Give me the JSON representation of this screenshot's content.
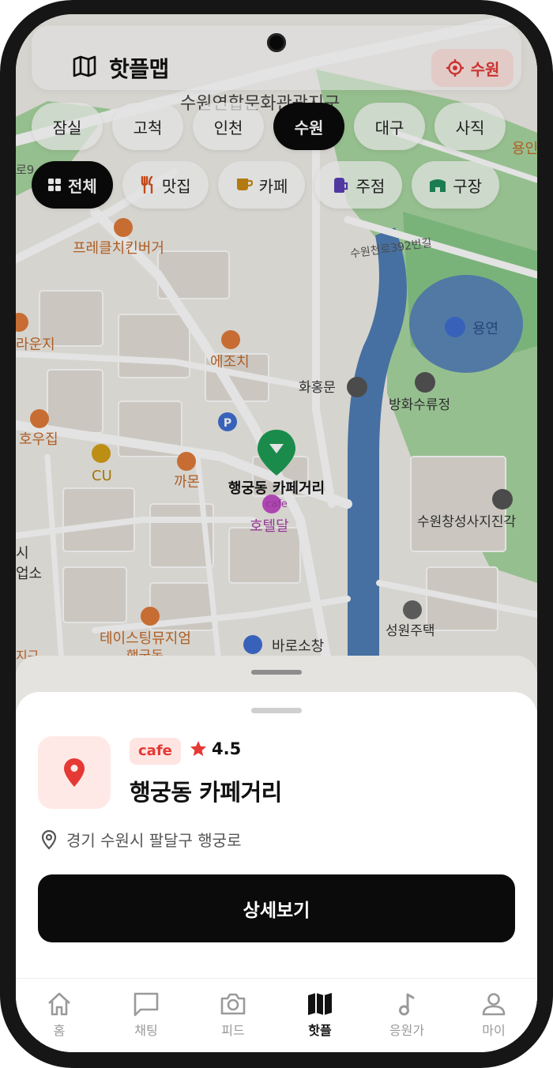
{
  "app": {
    "title": "핫플맵"
  },
  "location_button": {
    "label": "수원",
    "icon": "crosshair-icon"
  },
  "cities": [
    {
      "label": "잠실",
      "active": false
    },
    {
      "label": "고척",
      "active": false
    },
    {
      "label": "인천",
      "active": false
    },
    {
      "label": "수원",
      "active": true
    },
    {
      "label": "대구",
      "active": false
    },
    {
      "label": "사직",
      "active": false
    }
  ],
  "categories": [
    {
      "label": "전체",
      "icon": "grid-icon",
      "active": true
    },
    {
      "label": "맛집",
      "icon": "fork-knife-icon",
      "active": false
    },
    {
      "label": "카페",
      "icon": "coffee-cup-icon",
      "active": false
    },
    {
      "label": "주점",
      "icon": "beer-mug-icon",
      "active": false
    },
    {
      "label": "구장",
      "icon": "stadium-icon",
      "active": false
    }
  ],
  "map": {
    "labels": {
      "district": "수원연합문화관광지구",
      "pretzel": "프레클치킨버거",
      "lounge": "라운지",
      "ejochi": "에조치",
      "hwahongmun": "화홍문",
      "banghwa": "방화수류정",
      "yongyeon": "용연",
      "road": "수원천로392번길",
      "houjip": "호우집",
      "cu": "CU",
      "kamon": "까몬",
      "hotel": "호텔달",
      "suwon_changseong": "수원창성사지진각",
      "seongwon": "성원주택",
      "taste_museum": "테이스팅뮤지엄",
      "barosochang": "바로소창",
      "haenggungdong": "행궁동",
      "right_edge": "용인",
      "left_edge_1": "로9",
      "left_edge_2": "시",
      "left_edge_3": "업소",
      "left_edge_4": "지구"
    },
    "selected_pin": {
      "label": "행궁동 카페거리",
      "tag": "cafe",
      "color": "#1f9d55"
    }
  },
  "place": {
    "category": "cafe",
    "rating": "4.5",
    "name": "행궁동 카페거리",
    "address": "경기 수원시 팔달구 행궁로",
    "detail_button": "상세보기"
  },
  "nav": [
    {
      "label": "홈",
      "icon": "home-icon",
      "active": false
    },
    {
      "label": "채팅",
      "icon": "chat-icon",
      "active": false
    },
    {
      "label": "피드",
      "icon": "camera-icon",
      "active": false
    },
    {
      "label": "핫플",
      "icon": "map-icon",
      "active": true
    },
    {
      "label": "응원가",
      "icon": "music-note-icon",
      "active": false
    },
    {
      "label": "마이",
      "icon": "user-icon",
      "active": false
    }
  ],
  "colors": {
    "accent": "#e53935",
    "active_chip": "#0b0b0b",
    "map_water": "#5d88b8",
    "map_park": "#a8d5a2"
  }
}
